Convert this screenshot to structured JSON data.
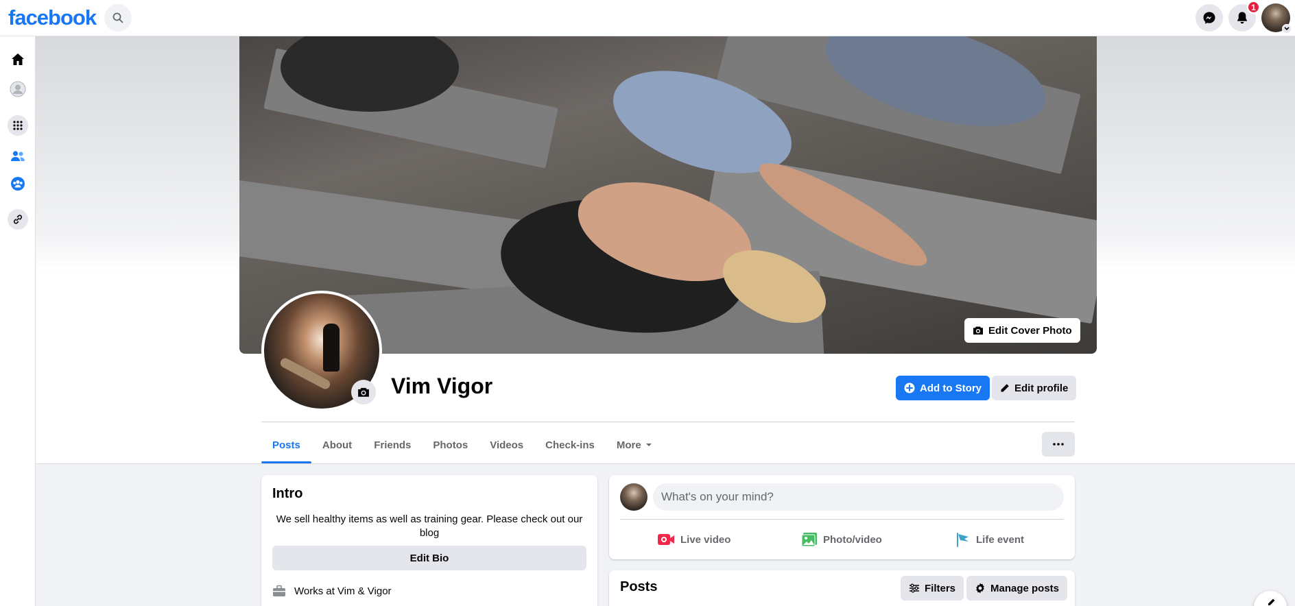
{
  "topbar": {
    "logo": "facebook",
    "notification_count": "1"
  },
  "left_rail": [
    "home-icon",
    "profile-icon",
    "menu-grid-icon",
    "friends-icon",
    "groups-icon",
    "link-icon"
  ],
  "profile": {
    "name": "Vim Vigor",
    "edit_cover_label": "Edit Cover Photo",
    "add_story_label": "Add to Story",
    "edit_profile_label": "Edit profile"
  },
  "tabs": [
    {
      "label": "Posts",
      "active": true
    },
    {
      "label": "About"
    },
    {
      "label": "Friends"
    },
    {
      "label": "Photos"
    },
    {
      "label": "Videos"
    },
    {
      "label": "Check-ins"
    },
    {
      "label": "More"
    }
  ],
  "intro": {
    "title": "Intro",
    "bio": "We sell healthy items as well as training gear. Please check out our blog",
    "edit_bio_label": "Edit Bio",
    "works_prefix": "Works at",
    "works_place": "Vim & Vigor"
  },
  "composer": {
    "placeholder": "What's on your mind?",
    "actions": {
      "live": "Live video",
      "photo": "Photo/video",
      "life": "Life event"
    }
  },
  "posts": {
    "title": "Posts",
    "filters_label": "Filters",
    "manage_label": "Manage posts"
  },
  "colors": {
    "brand": "#1877f2",
    "page_bg": "#f0f2f5",
    "notification": "#e41e3f",
    "live": "#f02849",
    "photo": "#45bd62",
    "life": "#3ea2c8"
  }
}
